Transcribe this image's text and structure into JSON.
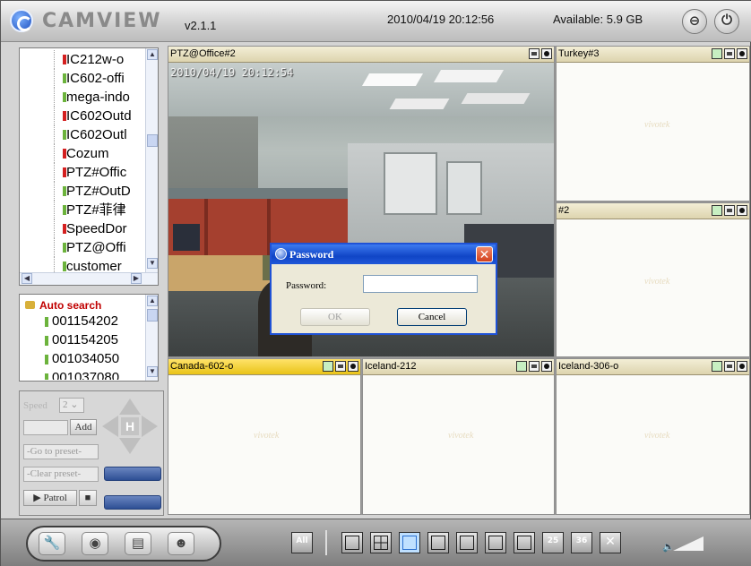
{
  "header": {
    "app_name": "CAMVIEW",
    "version": "v2.1.1",
    "datetime": "2010/04/19 20:12:56",
    "available": "Available: 5.9 GB"
  },
  "device_tree": {
    "items": [
      {
        "label": "IC212w-o",
        "color": "#d42020"
      },
      {
        "label": "IC602-offi",
        "color": "#6cb33c"
      },
      {
        "label": "mega-indo",
        "color": "#6cb33c"
      },
      {
        "label": "IC602Outd",
        "color": "#d42020"
      },
      {
        "label": "IC602Outl",
        "color": "#6cb33c"
      },
      {
        "label": "Cozum",
        "color": "#d42020"
      },
      {
        "label": "PTZ#Offic",
        "color": "#d42020"
      },
      {
        "label": "PTZ#OutD",
        "color": "#6cb33c"
      },
      {
        "label": "PTZ#菲律",
        "color": "#6cb33c"
      },
      {
        "label": "SpeedDor",
        "color": "#d42020"
      },
      {
        "label": "PTZ@Offi",
        "color": "#6cb33c"
      },
      {
        "label": "customer",
        "color": "#6cb33c"
      }
    ]
  },
  "auto_search": {
    "title": "Auto search",
    "items": [
      "001154202",
      "001154205",
      "001034050",
      "001037080"
    ]
  },
  "ptz": {
    "speed_label": "Speed",
    "speed_value": "2",
    "add_label": "Add",
    "goto_preset": "-Go to preset-",
    "clear_preset": "-Clear preset-",
    "patrol_label": "Patrol"
  },
  "tiles": {
    "main": {
      "title": "PTZ@Office#2",
      "osd": "2010/04/19 20:12:54"
    },
    "t1": {
      "title": "Turkey#3"
    },
    "t2": {
      "title": "#2"
    },
    "t3": {
      "title": "Canada-602-o"
    },
    "t4": {
      "title": "Iceland-212"
    },
    "t5": {
      "title": "Iceland-306-o"
    },
    "watermark": "vivotek"
  },
  "dialog": {
    "title": "Password",
    "field_label": "Password:",
    "password_value": "",
    "ok_label": "OK",
    "cancel_label": "Cancel"
  },
  "toolbar": {
    "all_label": "All",
    "layout_25": "25",
    "layout_36": "36"
  }
}
